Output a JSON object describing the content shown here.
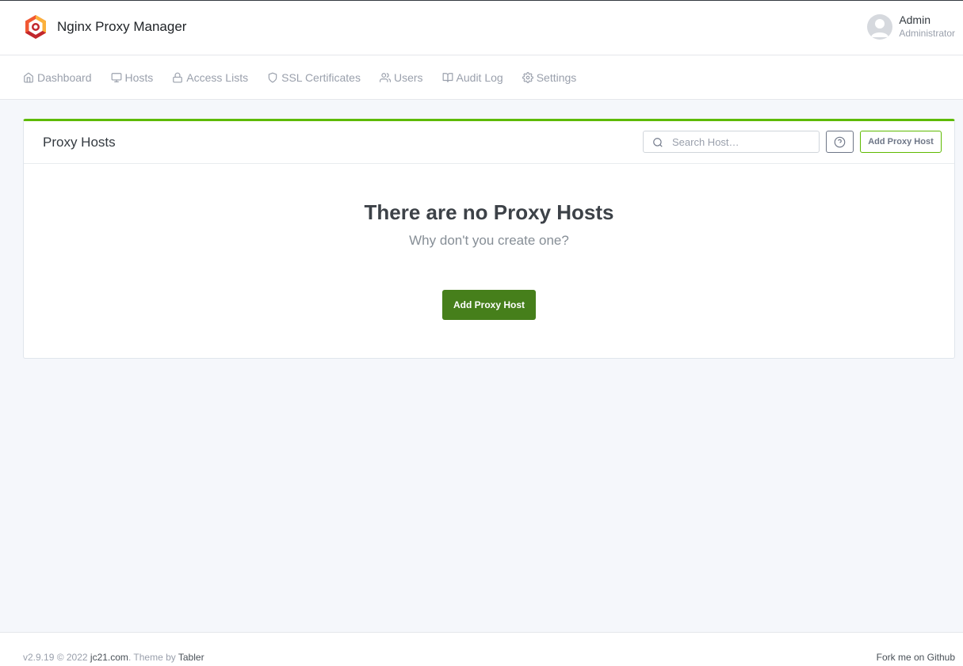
{
  "app": {
    "title": "Nginx Proxy Manager",
    "logo_icon": "nginx-proxy-manager-logo",
    "accent_color": "#5eba00"
  },
  "user": {
    "name": "Admin",
    "role": "Administrator",
    "avatar_icon": "user-avatar-icon"
  },
  "nav": {
    "items": [
      {
        "label": "Dashboard",
        "icon": "home-icon"
      },
      {
        "label": "Hosts",
        "icon": "monitor-icon"
      },
      {
        "label": "Access Lists",
        "icon": "lock-icon"
      },
      {
        "label": "SSL Certificates",
        "icon": "shield-icon"
      },
      {
        "label": "Users",
        "icon": "users-icon"
      },
      {
        "label": "Audit Log",
        "icon": "book-open-icon"
      },
      {
        "label": "Settings",
        "icon": "gear-icon"
      }
    ]
  },
  "card": {
    "title": "Proxy Hosts",
    "search_placeholder": "Search Host…",
    "help_icon": "help-circle-icon",
    "add_button_label": "Add Proxy Host",
    "empty_title": "There are no Proxy Hosts",
    "empty_subtitle": "Why don't you create one?",
    "empty_add_button_label": "Add Proxy Host"
  },
  "footer": {
    "version_text": "v2.9.19 © 2022 ",
    "author_link": "jc21.com",
    "theme_text": ". Theme by ",
    "theme_link": "Tabler",
    "github_link": "Fork me on Github"
  }
}
